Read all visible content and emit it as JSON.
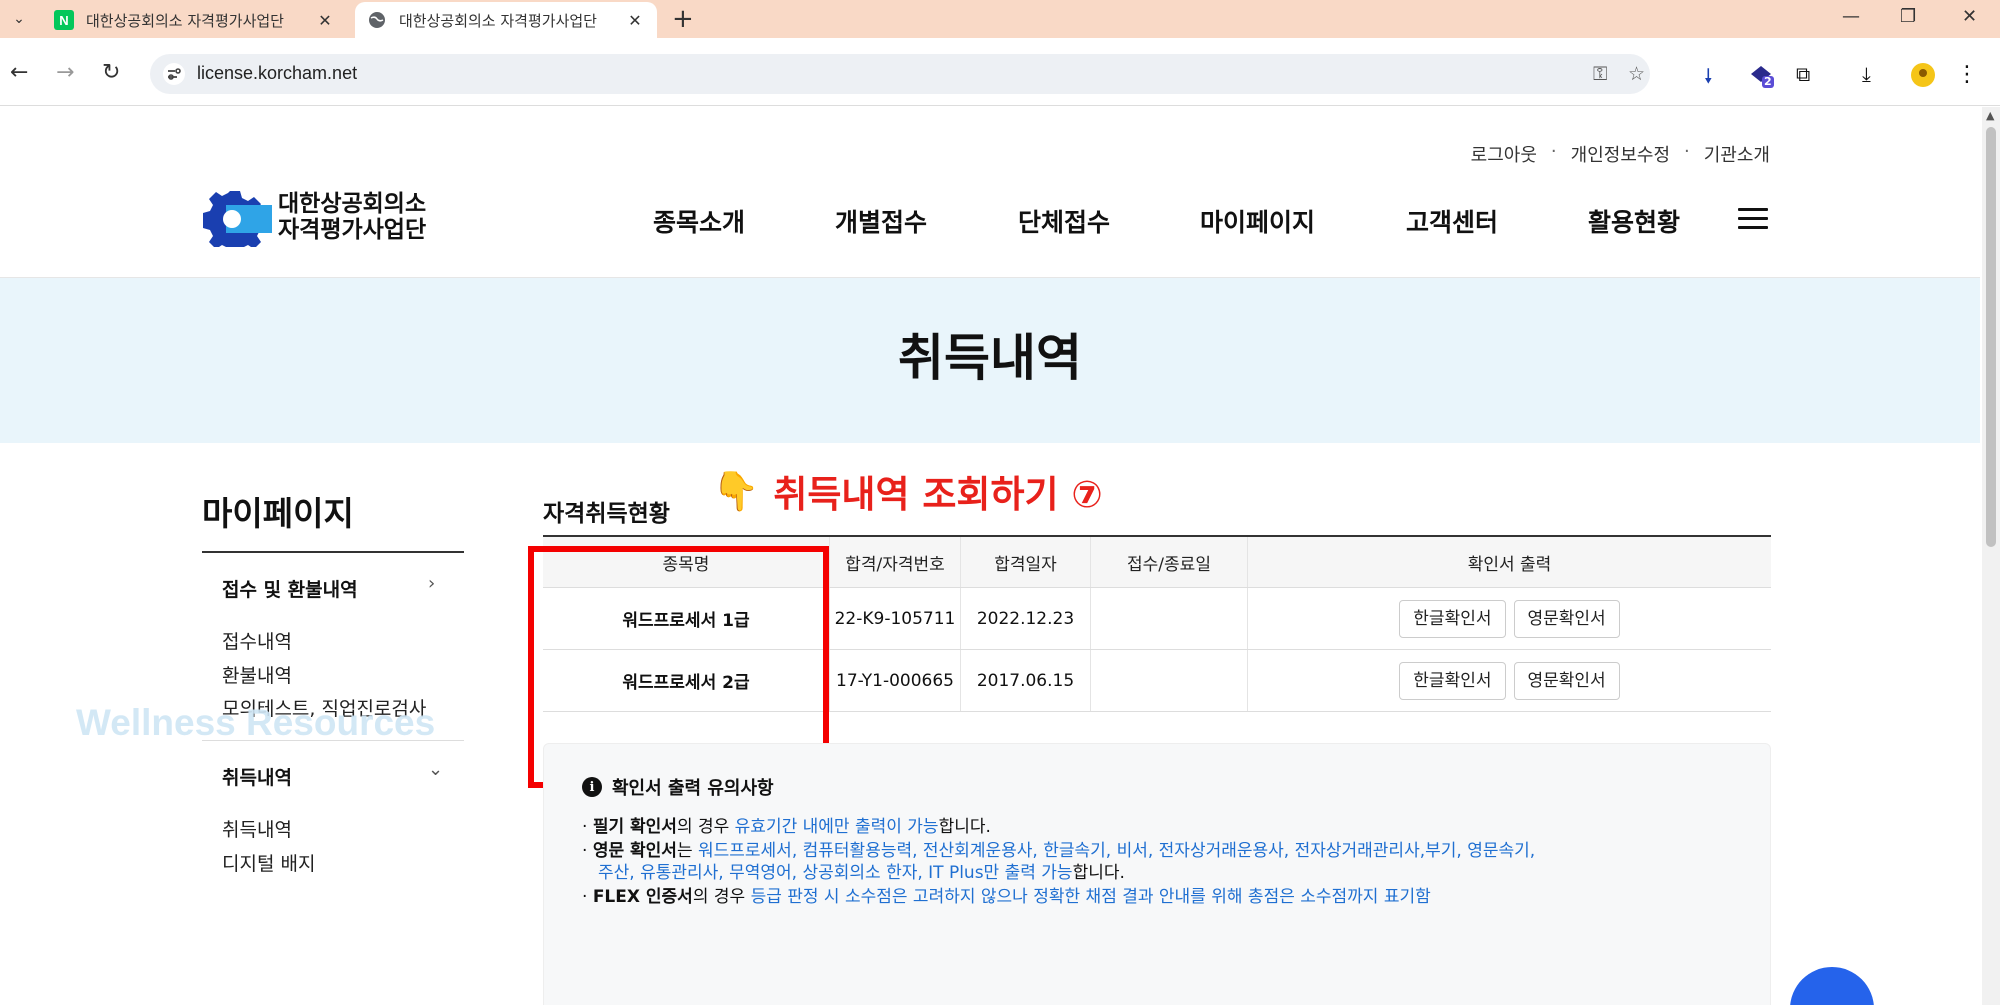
{
  "browser": {
    "tabs": [
      {
        "title": "대한상공회의소 자격평가사업단",
        "favicon": "naver-icon",
        "favicon_text": "N"
      },
      {
        "title": "대한상공회의소 자격평가사업단",
        "favicon": "globe-icon"
      }
    ],
    "url": "license.korcham.net",
    "extension_badge": "2"
  },
  "site": {
    "logo_line1": "대한상공회의소",
    "logo_line2": "자격평가사업단",
    "util_links": [
      "로그아웃",
      "개인정보수정",
      "기관소개"
    ],
    "util_sep": "·",
    "nav": [
      "종목소개",
      "개별접수",
      "단체접수",
      "마이페이지",
      "고객센터",
      "활용현황"
    ]
  },
  "banner": {
    "title": "취득내역"
  },
  "sidebar": {
    "title": "마이페이지",
    "sections": [
      {
        "label": "접수 및 환불내역",
        "items": [
          "접수내역",
          "환불내역",
          "모의테스트, 직업진로검사"
        ]
      },
      {
        "label": "취득내역",
        "items": [
          "취득내역",
          "디지털 배지"
        ]
      }
    ]
  },
  "main": {
    "section_title": "자격취득현황",
    "callout": "취득내역 조회하기 ⑦",
    "table": {
      "headers": [
        "종목명",
        "합격/자격번호",
        "합격일자",
        "접수/종료일",
        "확인서 출력"
      ],
      "rows": [
        {
          "name": "워드프로세서 1급",
          "number": "22-K9-105711",
          "date": "2022.12.23",
          "period": "",
          "btn_kr": "한글확인서",
          "btn_en": "영문확인서"
        },
        {
          "name": "워드프로세서 2급",
          "number": "17-Y1-000665",
          "date": "2017.06.15",
          "period": "",
          "btn_kr": "한글확인서",
          "btn_en": "영문확인서"
        }
      ]
    },
    "notice": {
      "title": "확인서 출력 유의사항",
      "line1": {
        "a": "필기 확인서",
        "b": "의 경우 ",
        "c": "유효기간 내에만 출력이 가능",
        "d": "합니다."
      },
      "line2": {
        "a": "영문 확인서",
        "b": "는 ",
        "c": "워드프로세서, 컴퓨터활용능력, 전산회계운용사, 한글속기, 비서, 전자상거래운용사, 전자상거래관리사,부기, 영문속기,"
      },
      "line3": {
        "c": "주산, 유통관리사, 무역영어, 상공회의소 한자, IT Plus만 출력 가능",
        "d": "합니다."
      },
      "line4": {
        "a": "FLEX 인증서",
        "b": "의 경우 ",
        "c": "등급 판정 시 소수점은 고려하지 않으나 정확한 채점 결과 안내를 위해 총점은 소수점까지 표기함"
      }
    }
  },
  "watermark": "Wellness Resources",
  "colors": {
    "accent_red": "#e8211b",
    "box_red": "#f40000",
    "link_blue": "#1f6fd1",
    "banner_bg": "#e9f5fb",
    "tabbar_bg": "#f9d9c6"
  }
}
